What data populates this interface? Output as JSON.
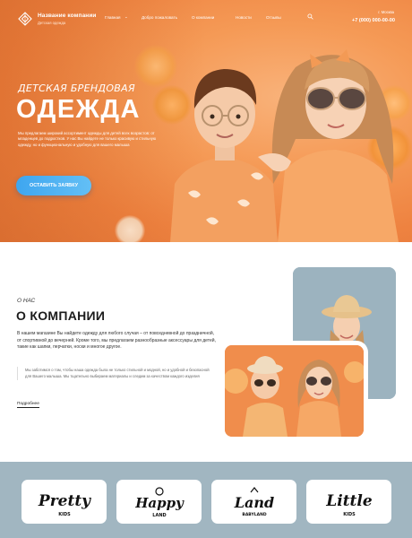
{
  "header": {
    "logo_title": "Название компании",
    "logo_subtitle": "Детская одежда",
    "nav": [
      {
        "label": "Главная"
      },
      {
        "label": "Добро пожаловать"
      },
      {
        "label": "О компании"
      },
      {
        "label": "Новости"
      },
      {
        "label": "Отзывы"
      }
    ],
    "city": "г. Москва",
    "phone": "+7 (000) 000-00-00"
  },
  "hero": {
    "eyebrow": "ДЕТСКАЯ БРЕНДОВАЯ",
    "headline": "ОДЕЖДА",
    "text": "Мы предлагаем широкий ассортимент одежды для детей всех возрастов: от младенцев до подростков. У нас Вы найдете не только красивую и стильную одежду, но и функциональную и удобную для вашего малыша",
    "cta_label": "ОСТАВИТЬ ЗАЯВКУ"
  },
  "about": {
    "eyebrow": "О НАС",
    "title": "О КОМПАНИИ",
    "text": "В нашем магазине Вы найдете одежду для любого случая – от повседневной до праздничной, от спортивной до вечерней. Кроме того, мы предлагаем разнообразные аксессуары для детей, такие как шапки, перчатки, носки и многое другое.",
    "quote": "Мы заботимся о том, чтобы наша одежда была не только стильной и модной, но и удобной и безопасной для Вашего малыша. Мы тщательно выбираем материалы и следим за качеством каждого изделия",
    "more_label": "Подробнее"
  },
  "brands": [
    {
      "name": "Pretty",
      "sub": "KIDS"
    },
    {
      "name": "Happy",
      "sub": "LAND"
    },
    {
      "name": "Land",
      "sub": "BABYLAND"
    },
    {
      "name": "Little",
      "sub": "KIDS"
    }
  ],
  "colors": {
    "hero_orange": "#ee8240",
    "cta_blue": "#3ea6f0",
    "brands_bg": "#a1b6c1"
  },
  "icons": {
    "logo": "diamond-lines-logo",
    "search": "search-icon",
    "dropdown": "chevron-down-icon"
  }
}
